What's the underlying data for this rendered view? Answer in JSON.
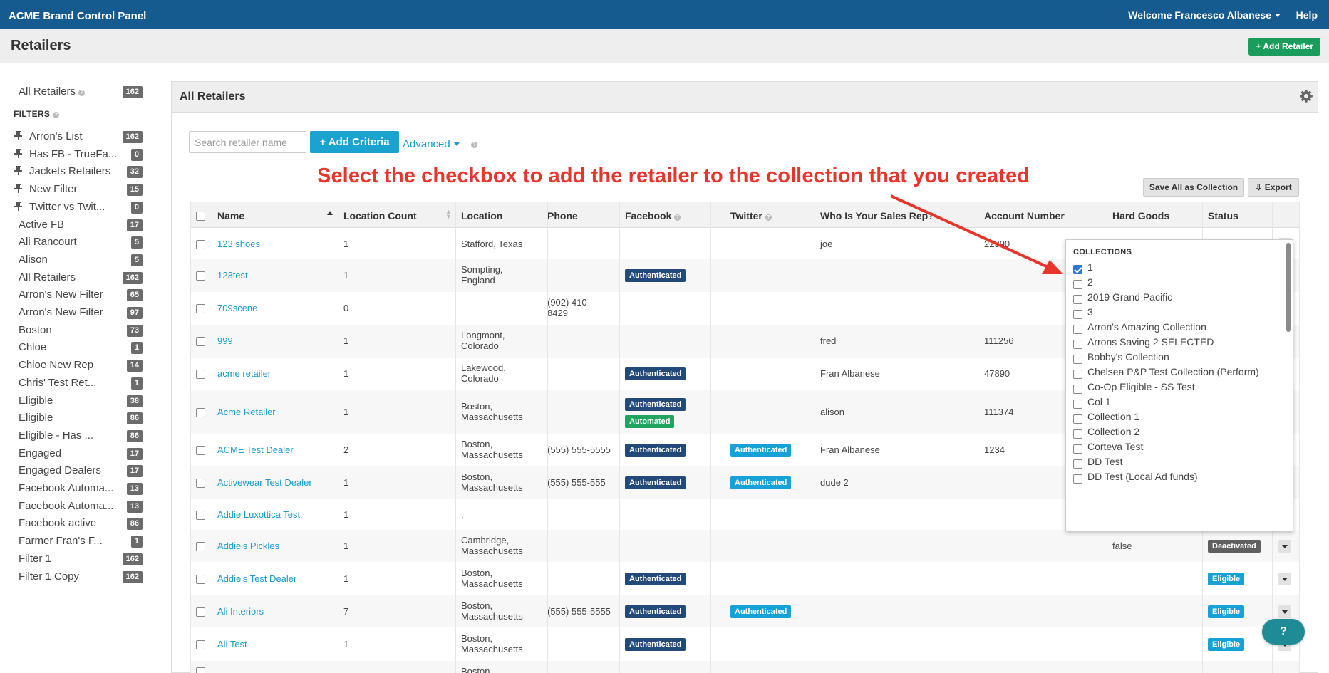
{
  "app": {
    "brand": "ACME Brand Control Panel",
    "welcome": "Welcome Francesco Albanese",
    "help": "Help"
  },
  "page": {
    "title": "Retailers",
    "add_button": "+ Add Retailer"
  },
  "sidebar": {
    "all": {
      "label": "All Retailers",
      "count": "162"
    },
    "filters_label": "FILTERS",
    "items": [
      {
        "label": "Arron's List",
        "count": "162",
        "pinned": true
      },
      {
        "label": "Has FB - TrueFa...",
        "count": "0",
        "pinned": true
      },
      {
        "label": "Jackets Retailers",
        "count": "32",
        "pinned": true
      },
      {
        "label": "New Filter",
        "count": "15",
        "pinned": true
      },
      {
        "label": "Twitter vs Twit...",
        "count": "0",
        "pinned": true
      },
      {
        "label": "Active FB",
        "count": "17"
      },
      {
        "label": "Ali Rancourt",
        "count": "5"
      },
      {
        "label": "Alison",
        "count": "5"
      },
      {
        "label": "All Retailers",
        "count": "162"
      },
      {
        "label": "Arron's New Filter",
        "count": "65"
      },
      {
        "label": "Arron's New Filter",
        "count": "97"
      },
      {
        "label": "Boston",
        "count": "73"
      },
      {
        "label": "Chloe",
        "count": "1"
      },
      {
        "label": "Chloe New Rep",
        "count": "14"
      },
      {
        "label": "Chris' Test Ret...",
        "count": "1"
      },
      {
        "label": "Eligible",
        "count": "38"
      },
      {
        "label": "Eligible",
        "count": "86"
      },
      {
        "label": "Eligible - Has ...",
        "count": "86"
      },
      {
        "label": "Engaged",
        "count": "17"
      },
      {
        "label": "Engaged Dealers",
        "count": "17"
      },
      {
        "label": "Facebook Automa...",
        "count": "13"
      },
      {
        "label": "Facebook Automa...",
        "count": "13"
      },
      {
        "label": "Facebook active",
        "count": "86"
      },
      {
        "label": "Farmer Fran's F...",
        "count": "1"
      },
      {
        "label": "Filter 1",
        "count": "162"
      },
      {
        "label": "Filter 1 Copy",
        "count": "162"
      }
    ]
  },
  "panel": {
    "title": "All Retailers",
    "search_placeholder": "Search retailer name",
    "add_criteria": "+ Add Criteria",
    "advanced": "Advanced",
    "save_all": "Save All as Collection",
    "export": "Export"
  },
  "annotation": "Select the checkbox to add the retailer to the collection that you created",
  "table": {
    "headers": [
      "Name",
      "Location Count",
      "Location",
      "Phone",
      "Facebook",
      "Twitter",
      "Who Is Your Sales Rep?",
      "Account Number",
      "Hard Goods",
      "Status"
    ],
    "rows": [
      {
        "name": "123 shoes",
        "count": "1",
        "loc1": "Stafford, Texas",
        "loc2": "",
        "ph1": "",
        "ph2": "",
        "fb": "",
        "fb2": "",
        "tw": "",
        "rep": "joe",
        "acct": "22390",
        "hard": "",
        "status": ""
      },
      {
        "name": "123test",
        "count": "1",
        "loc1": "Sompting,",
        "loc2": "England",
        "ph1": "",
        "ph2": "",
        "fb": "Authenticated",
        "fb2": "",
        "tw": "",
        "rep": "",
        "acct": "",
        "hard": "",
        "status": ""
      },
      {
        "name": "709scene",
        "count": "0",
        "loc1": "",
        "loc2": "",
        "ph1": "(902) 410-",
        "ph2": "8429",
        "fb": "",
        "fb2": "",
        "tw": "",
        "rep": "",
        "acct": "",
        "hard": "",
        "status": ""
      },
      {
        "name": "999",
        "count": "1",
        "loc1": "Longmont,",
        "loc2": "Colorado",
        "ph1": "",
        "ph2": "",
        "fb": "",
        "fb2": "",
        "tw": "",
        "rep": "fred",
        "acct": "111256",
        "hard": "",
        "status": ""
      },
      {
        "name": "acme retailer",
        "count": "1",
        "loc1": "Lakewood,",
        "loc2": "Colorado",
        "ph1": "",
        "ph2": "",
        "fb": "Authenticated",
        "fb2": "",
        "tw": "",
        "rep": "Fran Albanese",
        "acct": "47890",
        "hard": "",
        "status": ""
      },
      {
        "name": "Acme Retailer",
        "count": "1",
        "loc1": "Boston,",
        "loc2": "Massachusetts",
        "ph1": "",
        "ph2": "",
        "fb": "Authenticated",
        "fb2": "Automated",
        "tw": "",
        "rep": "alison",
        "acct": "111374",
        "hard": "",
        "status": ""
      },
      {
        "name": "ACME Test Dealer",
        "count": "2",
        "loc1": "Boston,",
        "loc2": "Massachusetts",
        "ph1": "(555) 555-5555",
        "ph2": "",
        "fb": "Authenticated",
        "fb2": "",
        "tw": "Authenticated",
        "rep": "Fran Albanese",
        "acct": "1234",
        "hard": "",
        "status": ""
      },
      {
        "name": "Activewear Test Dealer",
        "count": "1",
        "loc1": "Boston,",
        "loc2": "Massachusetts",
        "ph1": "(555) 555-555",
        "ph2": "",
        "fb": "Authenticated",
        "fb2": "",
        "tw": "Authenticated",
        "rep": "dude 2",
        "acct": "",
        "hard": "",
        "status": ""
      },
      {
        "name": "Addie Luxottica Test",
        "count": "1",
        "loc1": ",",
        "loc2": "",
        "ph1": "",
        "ph2": "",
        "fb": "",
        "fb2": "",
        "tw": "",
        "rep": "",
        "acct": "",
        "hard": "",
        "status": ""
      },
      {
        "name": "Addie's Pickles",
        "count": "1",
        "loc1": "Cambridge,",
        "loc2": "Massachusetts",
        "ph1": "",
        "ph2": "",
        "fb": "",
        "fb2": "",
        "tw": "",
        "rep": "",
        "acct": "",
        "hard": "false",
        "status": "Deactivated"
      },
      {
        "name": "Addie's Test Dealer",
        "count": "1",
        "loc1": "Boston,",
        "loc2": "Massachusetts",
        "ph1": "",
        "ph2": "",
        "fb": "Authenticated",
        "fb2": "",
        "tw": "",
        "rep": "",
        "acct": "",
        "hard": "",
        "status": "Eligible"
      },
      {
        "name": "Ali Interiors",
        "count": "7",
        "loc1": "Boston,",
        "loc2": "Massachusetts",
        "ph1": "(555) 555-5555",
        "ph2": "",
        "fb": "Authenticated",
        "fb2": "",
        "tw": "Authenticated",
        "rep": "",
        "acct": "",
        "hard": "",
        "status": "Eligible"
      },
      {
        "name": "Ali Test",
        "count": "1",
        "loc1": "Boston,",
        "loc2": "Massachusetts",
        "ph1": "",
        "ph2": "",
        "fb": "Authenticated",
        "fb2": "",
        "tw": "",
        "rep": "",
        "acct": "",
        "hard": "",
        "status": "Eligible"
      },
      {
        "name": "",
        "count": "",
        "loc1": "Boston,",
        "loc2": "",
        "ph1": "",
        "ph2": "",
        "fb": "",
        "fb2": "",
        "tw": "",
        "rep": "",
        "acct": "",
        "hard": "",
        "status": ""
      }
    ]
  },
  "collections": {
    "title": "COLLECTIONS",
    "items": [
      {
        "label": "1",
        "checked": true
      },
      {
        "label": "2",
        "checked": false
      },
      {
        "label": "2019 Grand Pacific",
        "checked": false
      },
      {
        "label": "3",
        "checked": false
      },
      {
        "label": "Arron's Amazing Collection",
        "checked": false
      },
      {
        "label": "Arrons Saving 2 SELECTED",
        "checked": false
      },
      {
        "label": "Bobby's Collection",
        "checked": false
      },
      {
        "label": "Chelsea P&P Test Collection (Perform)",
        "checked": false
      },
      {
        "label": "Co-Op Eligible - SS Test",
        "checked": false
      },
      {
        "label": "Col 1",
        "checked": false
      },
      {
        "label": "Collection 1",
        "checked": false
      },
      {
        "label": "Collection 2",
        "checked": false
      },
      {
        "label": "Corteva Test",
        "checked": false
      },
      {
        "label": "DD Test",
        "checked": false
      },
      {
        "label": "DD Test (Local Ad funds)",
        "checked": false
      }
    ]
  },
  "help_widget": "?"
}
